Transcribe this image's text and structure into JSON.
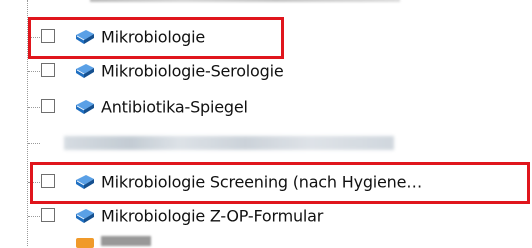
{
  "tree": {
    "items": [
      {
        "label": "Mikrobiologie",
        "checked": false,
        "icon": "blue-book-icon",
        "highlighted": true
      },
      {
        "label": "Mikrobiologie-Serologie",
        "checked": false,
        "icon": "blue-book-icon",
        "highlighted": false
      },
      {
        "label": "Antibiotika-Spiegel",
        "checked": false,
        "icon": "blue-book-icon",
        "highlighted": false
      },
      {
        "label": "",
        "checked": false,
        "icon": "blurred-item",
        "highlighted": false
      },
      {
        "label": "Mikrobiologie Screening (nach Hygiene…",
        "checked": false,
        "icon": "blue-book-icon",
        "highlighted": true
      },
      {
        "label": "Mikrobiologie Z-OP-Formular",
        "checked": false,
        "icon": "blue-book-icon",
        "highlighted": false
      }
    ]
  },
  "colors": {
    "highlight": "#e0151c",
    "book_blue": "#1f6fc1",
    "tree_line": "#9a9a9a"
  }
}
